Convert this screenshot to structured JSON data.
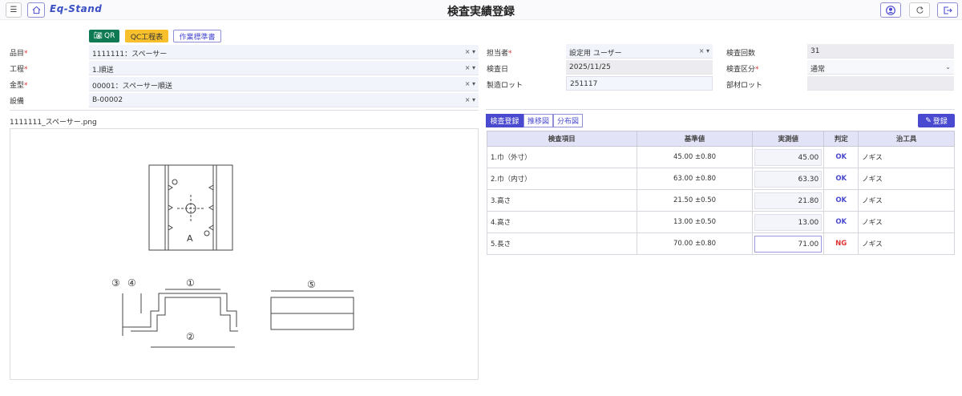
{
  "header": {
    "title": "検査実績登録",
    "logo": "Eq-Stand",
    "menu_icon": "hamburger-icon",
    "home_icon": "home-icon",
    "user_icon": "user-circle-icon",
    "refresh_icon": "refresh-icon",
    "logout_icon": "logout-icon"
  },
  "buttons": {
    "qr": "QR",
    "qc": "QC工程表",
    "work_std": "作業標準書",
    "register": "登録"
  },
  "colors": {
    "qr": "#0e7a54",
    "qc": "#f7c02c",
    "accent": "#4a4ad0",
    "ng": "#d33333"
  },
  "left_form": [
    {
      "label": "品目",
      "required": true,
      "value": "1111111：スペーサー"
    },
    {
      "label": "工程",
      "required": true,
      "value": "1.順送"
    },
    {
      "label": "金型",
      "required": true,
      "value": "00001：スペーサー順送"
    },
    {
      "label": "設備",
      "required": false,
      "value": "B-00002"
    }
  ],
  "right_form": {
    "tanto": {
      "label": "担当者",
      "value": "設定用 ユーザー"
    },
    "date": {
      "label": "検査日",
      "value": "2025/11/25"
    },
    "lot": {
      "label": "製造ロット",
      "value": "251117"
    },
    "count": {
      "label": "検査回数",
      "value": "31"
    },
    "kubun": {
      "label": "検査区分",
      "value": "通常"
    },
    "buzai": {
      "label": "部材ロット",
      "value": ""
    }
  },
  "image_file": "1111111_スペーサー.png",
  "drawing_labels": {
    "a": "A",
    "d1": "①",
    "d2": "②",
    "d3": "③",
    "d4": "④",
    "d5": "⑤"
  },
  "tabs": [
    "検査登録",
    "推移図",
    "分布図"
  ],
  "table": {
    "headers": [
      "検査項目",
      "基準値",
      "実測値",
      "判定",
      "治工具"
    ],
    "rows": [
      {
        "item": "1.巾（外寸）",
        "std": "45.00 ±0.80",
        "meas": "45.00",
        "judge": "OK",
        "tool": "ノギス"
      },
      {
        "item": "2.巾（内寸）",
        "std": "63.00 ±0.80",
        "meas": "63.30",
        "judge": "OK",
        "tool": "ノギス"
      },
      {
        "item": "3.高さ",
        "std": "21.50 ±0.50",
        "meas": "21.80",
        "judge": "OK",
        "tool": "ノギス"
      },
      {
        "item": "4.高さ",
        "std": "13.00 ±0.50",
        "meas": "13.00",
        "judge": "OK",
        "tool": "ノギス"
      },
      {
        "item": "5.長さ",
        "std": "70.00 ±0.80",
        "meas": "71.00",
        "judge": "NG",
        "tool": "ノギス"
      }
    ]
  }
}
